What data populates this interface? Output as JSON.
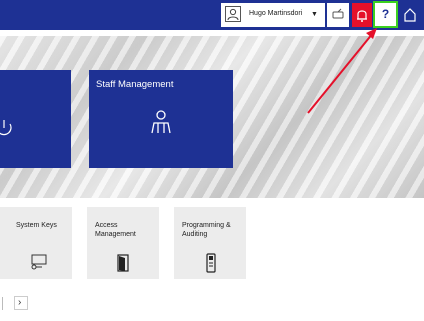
{
  "header": {
    "user_name": "Hugo Martinsdori",
    "icons": [
      "user-icon",
      "chevron-down-icon",
      "key-icon",
      "bell-icon",
      "help-icon",
      "home-icon"
    ],
    "help_label": "?"
  },
  "hero": {
    "tiles": [
      {
        "label": "",
        "icon": "power-icon"
      },
      {
        "label": "Staff Management",
        "icon": "staff-icon"
      }
    ]
  },
  "tiles": [
    {
      "label": "System Keys",
      "icon": "system-keys-icon"
    },
    {
      "label": "Access Management",
      "icon": "door-icon"
    },
    {
      "label": "Programming & Auditing",
      "icon": "programmer-device-icon"
    }
  ],
  "pager": {
    "next_label": "›"
  },
  "colors": {
    "brand_blue": "#1e3194",
    "alert_red": "#e5102a",
    "highlight_green": "#3bd11f",
    "annotation_red": "#e5102a"
  }
}
